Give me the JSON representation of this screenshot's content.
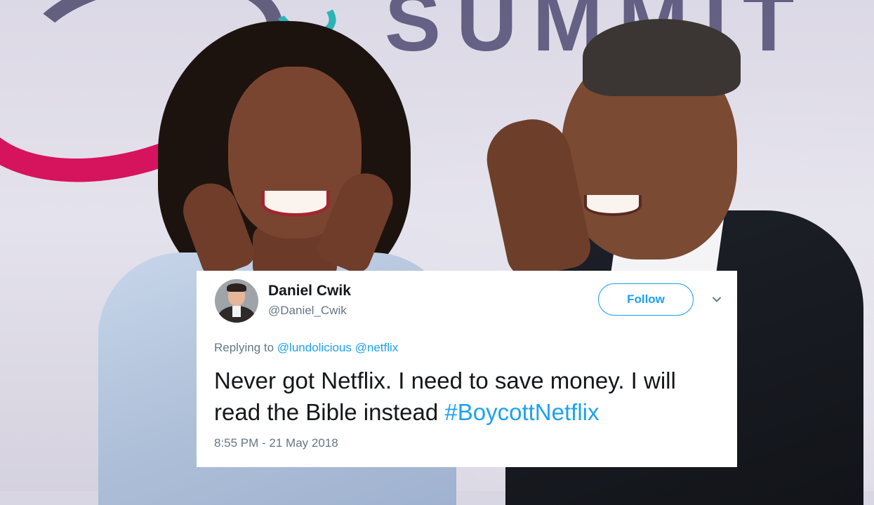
{
  "background": {
    "banner_text": "SUMMIT",
    "brand_colors": {
      "magenta": "#d6135d",
      "purple": "#4d4a6e",
      "teal": "#2bb3b6"
    }
  },
  "tweet": {
    "author": {
      "display_name": "Daniel Cwik",
      "handle": "@Daniel_Cwik",
      "avatar_icon": "user-avatar"
    },
    "follow_label": "Follow",
    "menu_icon": "chevron-down-icon",
    "replying_prefix": "Replying to",
    "replying_to": [
      "@lundolicious",
      "@netflix"
    ],
    "text": "Never got Netflix. I need to save money. I will read the Bible instead ",
    "hashtag": "#BoycottNetflix",
    "timestamp": "8:55 PM - 21 May 2018",
    "colors": {
      "accent": "#1da1f2",
      "text": "#14171a",
      "muted": "#657786"
    }
  }
}
